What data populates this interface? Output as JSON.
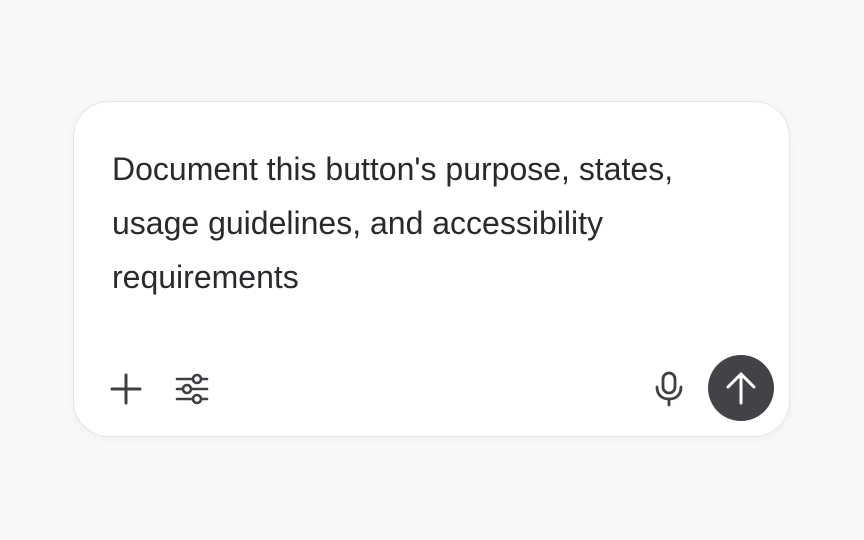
{
  "composer": {
    "prompt_text": "Document this button's purpose, states, usage guidelines, and accessibility requirements",
    "icons": {
      "add": "plus-icon",
      "tools": "sliders-icon",
      "voice": "microphone-icon",
      "send": "arrow-up-icon"
    },
    "colors": {
      "page_background": "#f8f8f8",
      "card_background": "#ffffff",
      "text": "#2a2a2e",
      "icon": "#3f3f44",
      "send_button": "#434347",
      "send_icon": "#ffffff"
    }
  }
}
